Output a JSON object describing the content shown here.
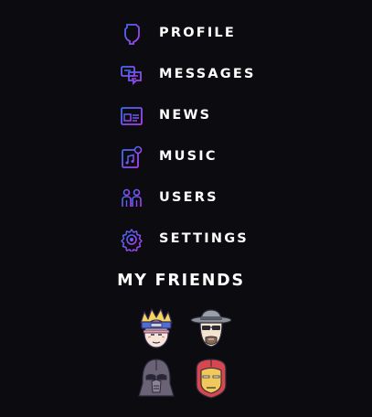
{
  "nav": {
    "items": [
      {
        "label": "PROFILE",
        "icon": "profile-icon"
      },
      {
        "label": "MESSAGES",
        "icon": "messages-icon"
      },
      {
        "label": "NEWS",
        "icon": "news-icon"
      },
      {
        "label": "MUSIC",
        "icon": "music-icon"
      },
      {
        "label": "USERS",
        "icon": "users-icon"
      },
      {
        "label": "SETTINGS",
        "icon": "settings-icon"
      }
    ]
  },
  "friends": {
    "title": "MY FRIENDS",
    "avatars": [
      {
        "icon": "ninja-headband-avatar-icon"
      },
      {
        "icon": "bald-man-sunglasses-hat-avatar-icon"
      },
      {
        "icon": "dark-helmet-avatar-icon"
      },
      {
        "icon": "iron-armor-avatar-icon"
      }
    ]
  },
  "colors": {
    "background": "#0b0b10",
    "text": "#ffffff",
    "icon_blue": "#3d6cf0",
    "icon_purple": "#a43df0"
  }
}
